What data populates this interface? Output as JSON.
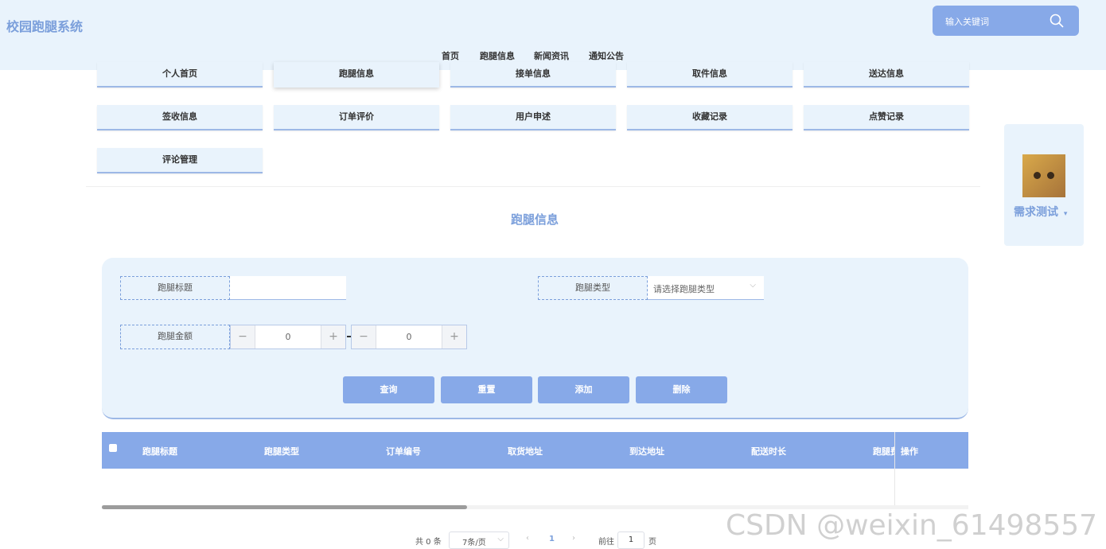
{
  "header": {
    "logo": "校园跑腿系统",
    "search_placeholder": "输入关键词",
    "nav": [
      "首页",
      "跑腿信息",
      "新闻资讯",
      "通知公告"
    ]
  },
  "tiles": [
    "个人首页",
    "跑腿信息",
    "接单信息",
    "取件信息",
    "送达信息",
    "签收信息",
    "订单评价",
    "用户申述",
    "收藏记录",
    "点赞记录",
    "评论管理"
  ],
  "user": {
    "name": "需求测试"
  },
  "page_title": "跑腿信息",
  "filters": {
    "title_label": "跑腿标题",
    "title_value": "",
    "type_label": "跑腿类型",
    "type_placeholder": "请选择跑腿类型",
    "amount_label": "跑腿金额",
    "amount_min": "0",
    "amount_max": "0"
  },
  "actions": [
    "查询",
    "重置",
    "添加",
    "删除"
  ],
  "table": {
    "columns": [
      "跑腿标题",
      "跑腿类型",
      "订单编号",
      "取货地址",
      "到达地址",
      "配送时长",
      "跑腿费"
    ],
    "op_column": "操作",
    "rows": []
  },
  "pagination": {
    "total": "共 0 条",
    "page_size": "7条/页",
    "current_page": "1",
    "goto_label": "前往",
    "goto_value": "1",
    "page_suffix": "页"
  },
  "watermark": "CSDN @weixin_61498557",
  "colors": {
    "accent": "#87a9e8",
    "panel": "#e9f3fc",
    "brand_text": "#7b9fdb"
  }
}
